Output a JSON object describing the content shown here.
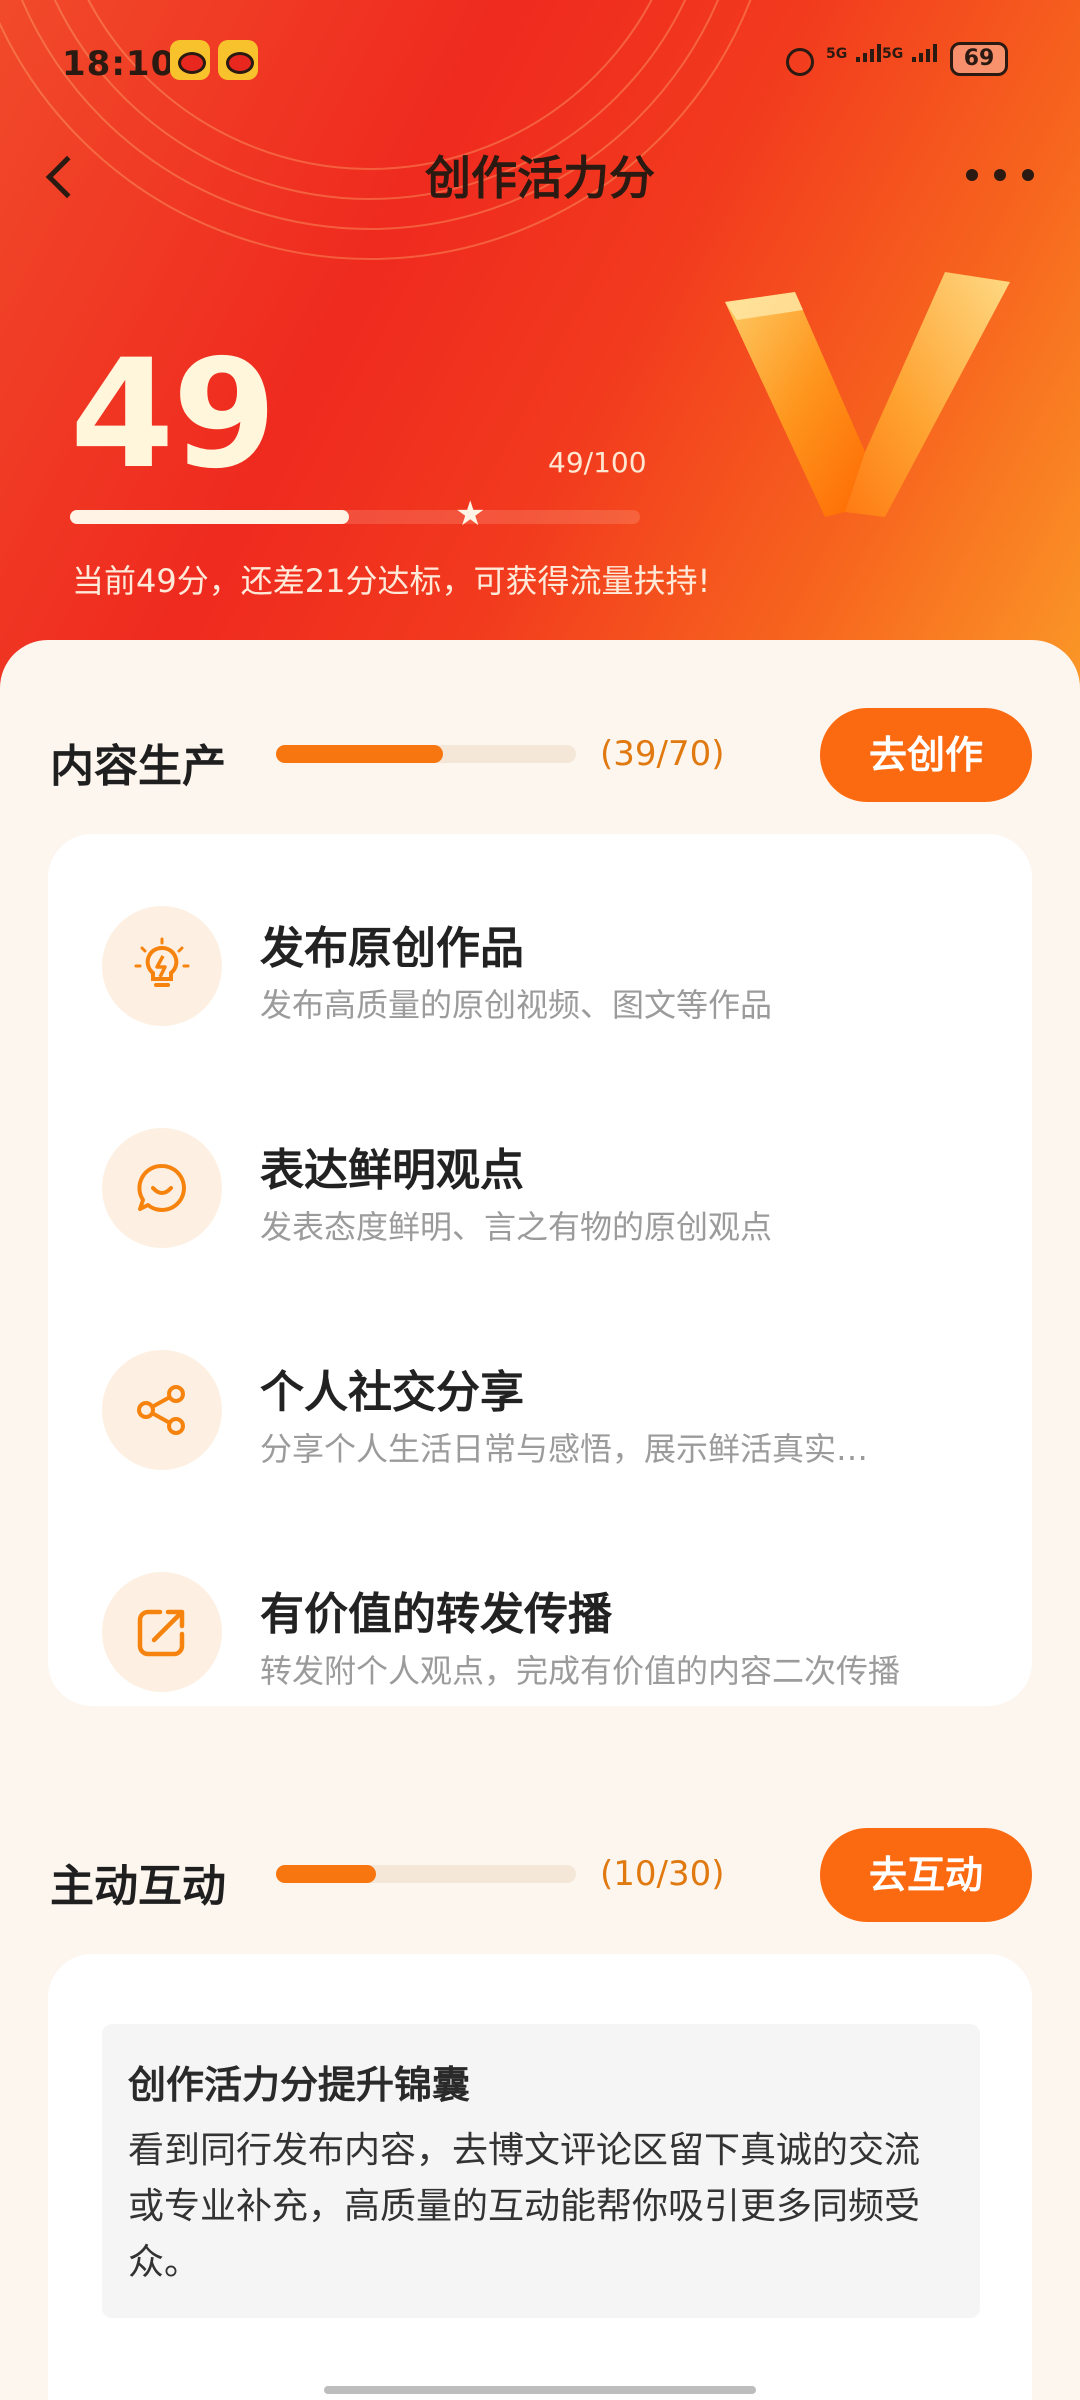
{
  "status_bar": {
    "time": "18:10",
    "net1": "5G",
    "net2": "5G",
    "battery": "69"
  },
  "header": {
    "title": "创作活力分"
  },
  "score": {
    "value": "49",
    "fraction": "49/100",
    "progress": 0.49,
    "tip": "当前49分，还差21分达标，可获得流量扶持!"
  },
  "sections": {
    "content": {
      "title": "内容生产",
      "progress_text": "(39/70)",
      "progress": 0.557,
      "button": "去创作",
      "tasks": [
        {
          "title": "发布原创作品",
          "desc": "发布高质量的原创视频、图文等作品",
          "icon": "lightbulb-icon"
        },
        {
          "title": "表达鲜明观点",
          "desc": "发表态度鲜明、言之有物的原创观点",
          "icon": "chat-bubble-icon"
        },
        {
          "title": "个人社交分享",
          "desc": "分享个人生活日常与感悟，展示鲜活真实…",
          "icon": "share-icon"
        },
        {
          "title": "有价值的转发传播",
          "desc": "转发附个人观点，完成有价值的内容二次传播",
          "icon": "forward-icon"
        }
      ]
    },
    "interaction": {
      "title": "主动互动",
      "progress_text": "(10/30)",
      "progress": 0.333,
      "button": "去互动",
      "tip_title": "创作活力分提升锦囊",
      "tip_body": "看到同行发布内容，去博文评论区留下真诚的交流或专业补充，高质量的互动能帮你吸引更多同频受众。"
    }
  },
  "colors": {
    "accent": "#fb6a10",
    "hero_red": "#ef2a1f",
    "hero_orange": "#fb9a28"
  }
}
